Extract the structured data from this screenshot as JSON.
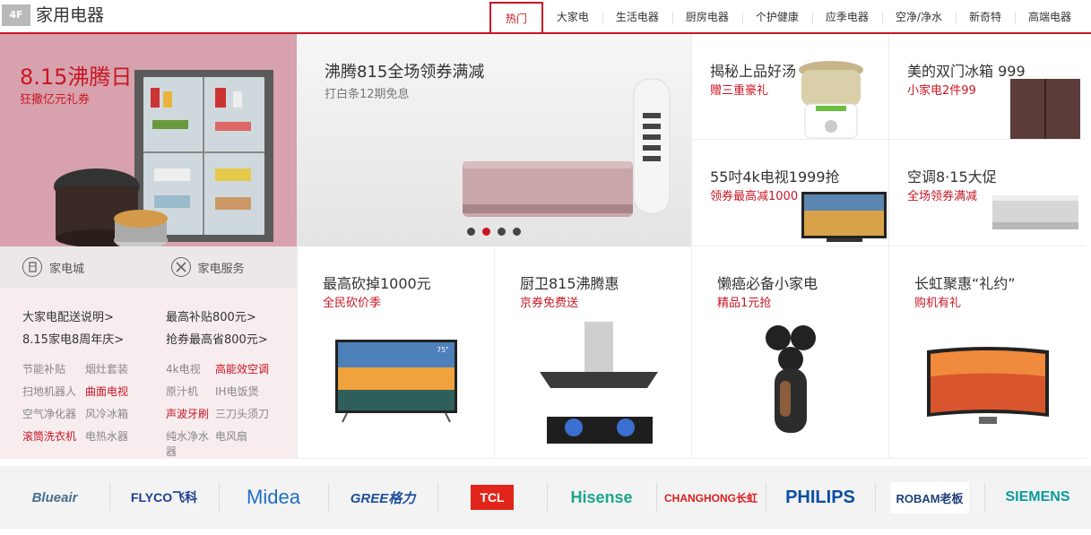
{
  "floor": {
    "badge": "4F",
    "title": "家用电器"
  },
  "tabs": [
    "热门",
    "大家电",
    "生活电器",
    "厨房电器",
    "个护健康",
    "应季电器",
    "空净/净水",
    "新奇特",
    "高端电器"
  ],
  "promo": {
    "title": "8.15沸腾日",
    "subtitle": "狂撒亿元礼券"
  },
  "services": [
    {
      "label": "家电城",
      "icon": "fridge-icon"
    },
    {
      "label": "家电服务",
      "icon": "wrench-screwdriver-icon"
    }
  ],
  "links": [
    "大家电配送说明>",
    "最高补贴800元>",
    "8.15家电8周年庆>",
    "抢券最高省800元>"
  ],
  "tags": [
    {
      "text": "节能补贴",
      "hot": false
    },
    {
      "text": "烟灶套装",
      "hot": false
    },
    {
      "text": "4k电视",
      "hot": false
    },
    {
      "text": "高能效空调",
      "hot": true
    },
    {
      "text": "扫地机器人",
      "hot": false
    },
    {
      "text": "曲面电视",
      "hot": true
    },
    {
      "text": "原汁机",
      "hot": false
    },
    {
      "text": "IH电饭煲",
      "hot": false
    },
    {
      "text": "空气净化器",
      "hot": false
    },
    {
      "text": "风冷冰箱",
      "hot": false
    },
    {
      "text": "声波牙刷",
      "hot": true
    },
    {
      "text": "三刀头须刀",
      "hot": false
    },
    {
      "text": "滚筒洗衣机",
      "hot": true
    },
    {
      "text": "电热水器",
      "hot": false
    },
    {
      "text": "纯水净水器",
      "hot": false
    },
    {
      "text": "电风扇",
      "hot": false
    }
  ],
  "banner": {
    "title": "沸腾815全场领券满减",
    "subtitle": "打白条12期免息",
    "active_dot": 1,
    "dot_count": 4
  },
  "small_cells": [
    {
      "title": "揭秘上品好汤",
      "subtitle": "赠三重豪礼"
    },
    {
      "title": "美的双门冰箱 999",
      "subtitle": "小家电2件99"
    },
    {
      "title": "55吋4k电视1999抢",
      "subtitle": "领券最高减1000"
    },
    {
      "title": "空调8·15大促",
      "subtitle": "全场领券满减"
    }
  ],
  "big_cells": [
    {
      "title": "最高砍掉1000元",
      "subtitle": "全民砍价季"
    },
    {
      "title": "厨卫815沸腾惠",
      "subtitle": "京券免费送"
    },
    {
      "title": "懒癌必备小家电",
      "subtitle": "精品1元抢"
    },
    {
      "title": "长虹聚惠“礼约”",
      "subtitle": "购机有礼"
    }
  ],
  "brands": [
    "Blueair",
    "FLYCO飞科",
    "Midea",
    "GREE格力",
    "TCL",
    "Hisense",
    "CHANGHONG长虹",
    "PHILIPS",
    "ROBAM老板",
    "SIEMENS"
  ],
  "tv_badge": "75\"",
  "colors": {
    "accent": "#c81623",
    "promo_bg": "#d7a2ad",
    "links_bg": "#f7ecee",
    "brand_bar": "#f3f3f3"
  }
}
